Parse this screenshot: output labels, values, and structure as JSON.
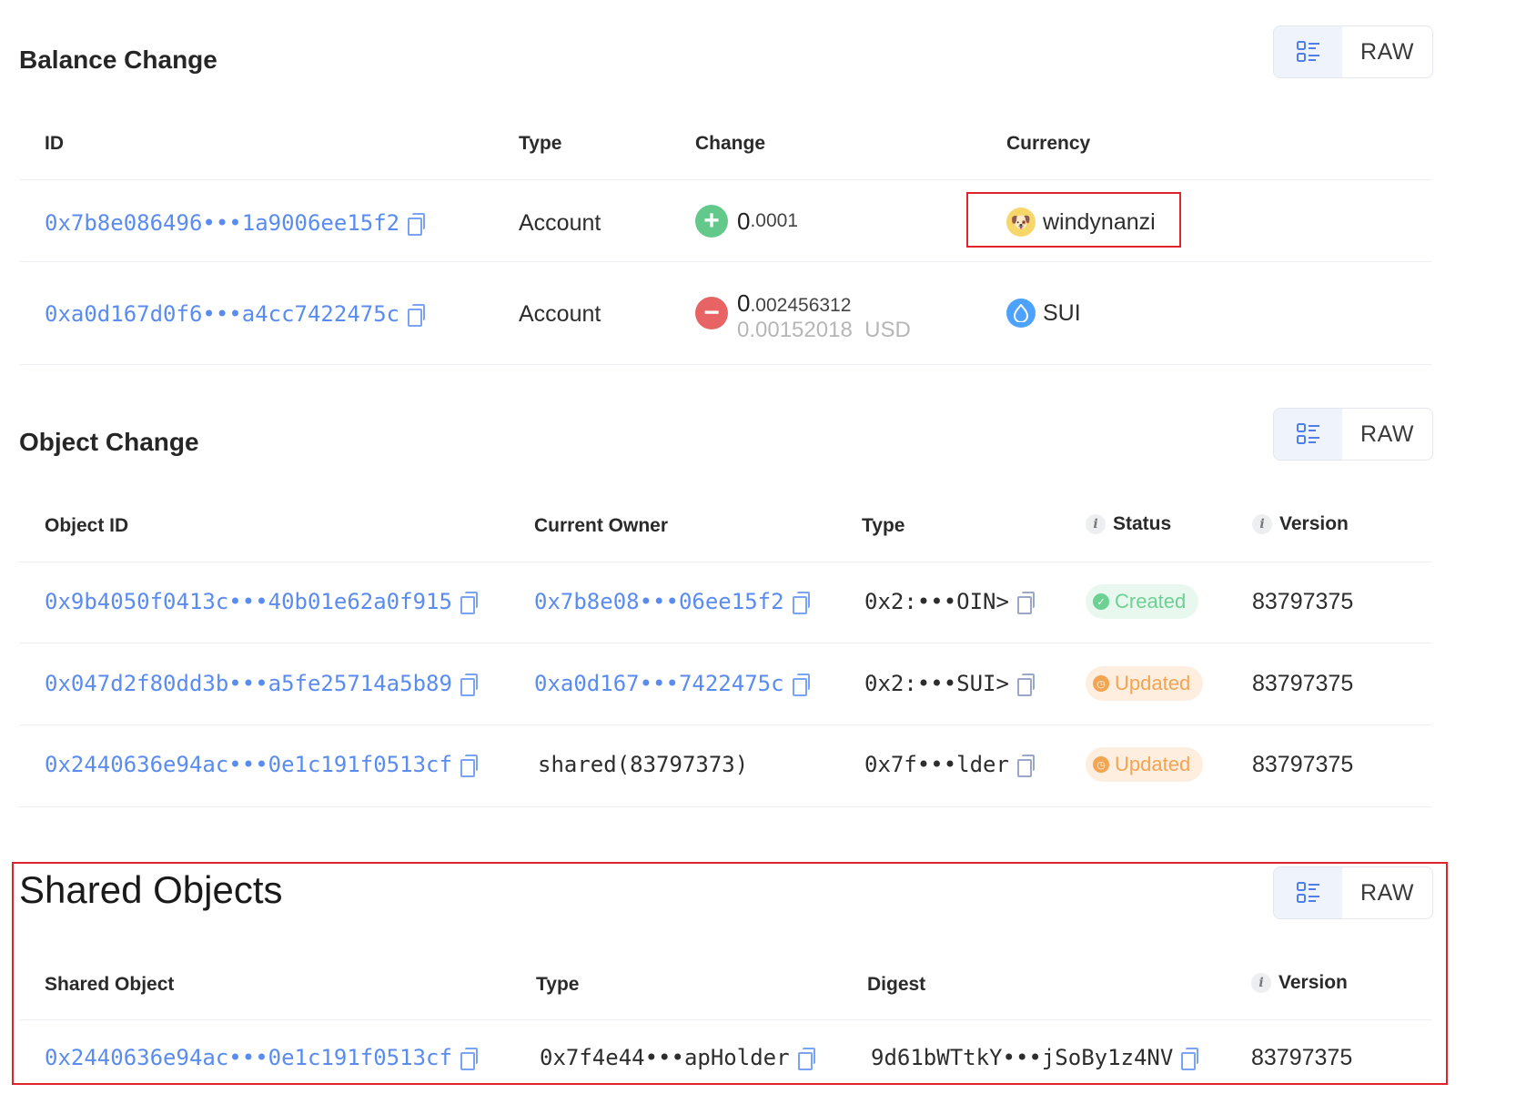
{
  "balance_change": {
    "title": "Balance Change",
    "raw_label": "RAW",
    "headers": {
      "id": "ID",
      "type": "Type",
      "change": "Change",
      "currency": "Currency"
    },
    "rows": [
      {
        "id": "0x7b8e086496•••1a9006ee15f2",
        "type": "Account",
        "sign": "+",
        "amount_int": "0",
        "amount_dec": ".0001",
        "usd": "",
        "currency": "windynanzi",
        "coin_icon": "dog-coin-icon"
      },
      {
        "id": "0xa0d167d0f6•••a4cc7422475c",
        "type": "Account",
        "sign": "−",
        "amount_int": "0",
        "amount_dec": ".002456312",
        "usd": "0.00152018  USD",
        "currency": "SUI",
        "coin_icon": "sui-coin-icon"
      }
    ]
  },
  "object_change": {
    "title": "Object Change",
    "raw_label": "RAW",
    "headers": {
      "object_id": "Object ID",
      "current_owner": "Current Owner",
      "type": "Type",
      "status": "Status",
      "version": "Version"
    },
    "rows": [
      {
        "object_id": "0x9b4050f0413c•••40b01e62a0f915",
        "owner": "0x7b8e08•••06ee15f2",
        "type": "0x2:•••OIN>",
        "status": "Created",
        "version": "83797375"
      },
      {
        "object_id": "0x047d2f80dd3b•••a5fe25714a5b89",
        "owner": "0xa0d167•••7422475c",
        "type": "0x2:•••SUI>",
        "status": "Updated",
        "version": "83797375"
      },
      {
        "object_id": "0x2440636e94ac•••0e1c191f0513cf",
        "owner": "shared(83797373)",
        "type": "0x7f•••lder",
        "status": "Updated",
        "version": "83797375"
      }
    ]
  },
  "shared_objects": {
    "title": "Shared Objects",
    "raw_label": "RAW",
    "headers": {
      "shared_object": "Shared Object",
      "type": "Type",
      "digest": "Digest",
      "version": "Version"
    },
    "rows": [
      {
        "shared_object": "0x2440636e94ac•••0e1c191f0513cf",
        "type": "0x7f4e44•••apHolder",
        "digest": "9d61bWTtkY•••jSoBy1z4NV",
        "version": "83797375"
      }
    ]
  },
  "colors": {
    "link": "#5a8cf0",
    "created": "#6cd192",
    "updated": "#f3a451",
    "highlight": "#e0242b"
  }
}
